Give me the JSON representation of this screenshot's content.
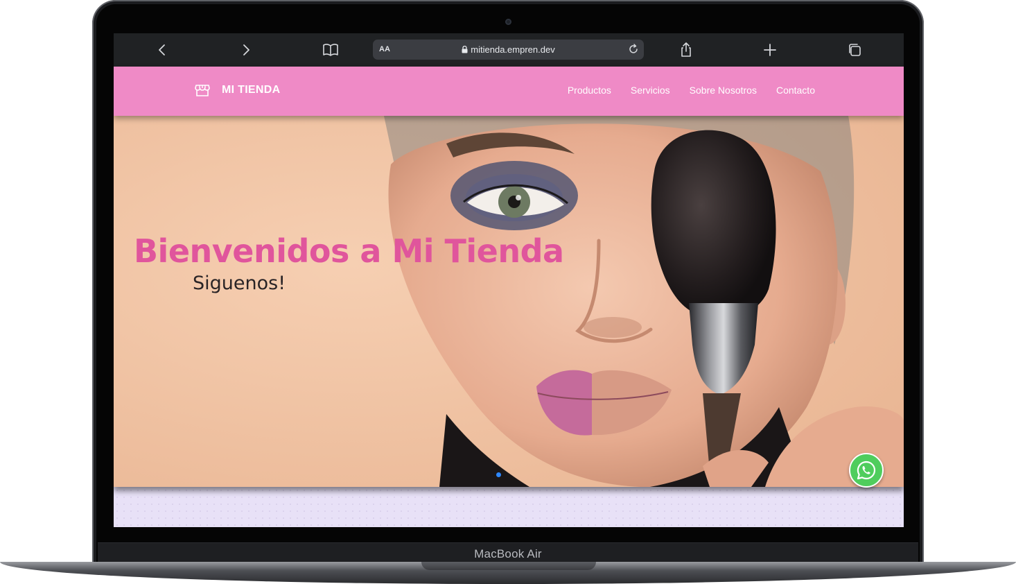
{
  "device": {
    "label": "MacBook Air"
  },
  "browser": {
    "reader_label": "AA",
    "url": "mitienda.empren.dev",
    "icons": [
      "back-icon",
      "forward-icon",
      "bookmarks-icon",
      "lock-icon",
      "reload-icon",
      "share-icon",
      "new-tab-icon",
      "tabs-icon"
    ]
  },
  "site": {
    "brand": "MI TIENDA",
    "nav": [
      "Productos",
      "Servicios",
      "Sobre Nosotros",
      "Contacto"
    ],
    "colors": {
      "header": "#ef8ac6",
      "title": "#e0559c",
      "background": "#e8e1f7",
      "whatsapp": "#4fcd5d",
      "carousel_dot": "#2d87ff"
    }
  },
  "hero": {
    "title": "Bienvenidos a Mi Tienda",
    "subtitle": "Siguenos!",
    "image": "woman-with-makeup-brush",
    "carousel": {
      "slides": 1,
      "active": 1
    }
  },
  "widgets": {
    "whatsapp_icon": "whatsapp-icon"
  }
}
